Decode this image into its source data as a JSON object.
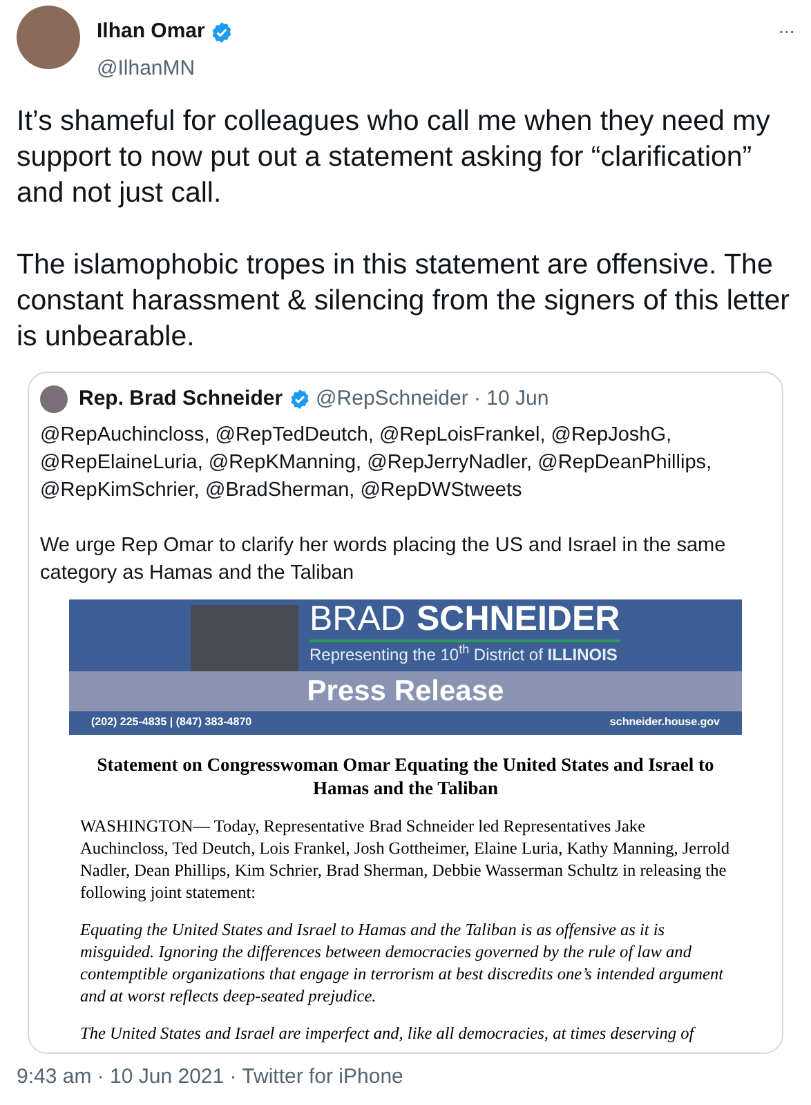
{
  "tweet": {
    "author": {
      "name": "Ilhan Omar",
      "handle": "@IlhanMN",
      "verified": true
    },
    "more": "···",
    "paragraphs": [
      "It’s shameful for colleagues who call me when they need my support to now put out a statement asking for “clarification” and not just call.",
      "The islamophobic tropes in this statement are offensive. The constant harassment & silencing from the signers of this letter is unbearable."
    ],
    "quoted": {
      "author": {
        "name": "Rep. Brad Schneider",
        "verified": true,
        "meta": "@RepSchneider · 10 Jun"
      },
      "mentions": "@RepAuchincloss, @RepTedDeutch, @RepLoisFrankel, @RepJoshG, @RepElaineLuria, @RepKManning, @RepJerryNadler, @RepDeanPhillips, @RepKimSchrier, @BradSherman, @RepDWStweets",
      "text": "We urge Rep Omar to clarify her words placing the US and Israel in the same category as Hamas and the Taliban",
      "document": {
        "banner": {
          "name_light": "BRAD",
          "name_bold": "SCHNEIDER",
          "tagline": "Representing the 10$^{th}$ District of **ILLINOIS**",
          "title": "Press Release",
          "phones": "(202) 225-4835 | (847) 383-4870",
          "website": "schneider.house.gov"
        },
        "heading": "Statement on Congresswoman Omar Equating the United States and Israel to Hamas and the Taliban",
        "paragraphs": [
          {
            "text": "WASHINGTON— Today, Representative Brad Schneider led Representatives Jake Auchincloss, Ted Deutch, Lois Frankel, Josh Gottheimer, Elaine Luria, Kathy Manning, Jerrold Nadler, Dean Phillips, Kim Schrier, Brad Sherman, Debbie Wasserman Schultz in releasing the following joint statement:",
            "italic": false
          },
          {
            "text": "Equating the United States and Israel to Hamas and the Taliban is as offensive as it is misguided. Ignoring the differences between democracies governed by the rule of law and contemptible organizations that engage in terrorism at best discredits one’s intended argument and at worst reflects deep-seated prejudice.",
            "italic": true
          },
          {
            "text": "The United States and Israel are imperfect and, like all democracies, at times deserving of",
            "italic": true
          }
        ]
      }
    },
    "footer": "9:43 am · 10 Jun 2021 · Twitter for iPhone"
  }
}
